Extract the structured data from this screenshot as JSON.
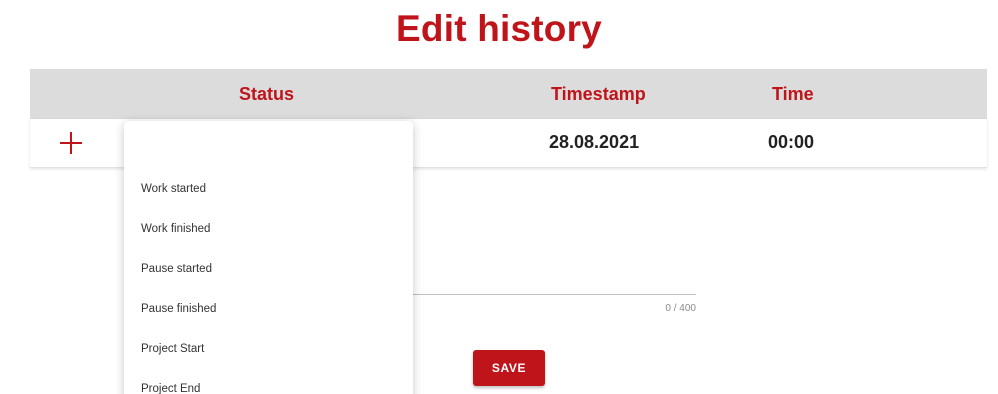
{
  "page": {
    "title": "Edit history"
  },
  "table": {
    "headers": {
      "status": "Status",
      "timestamp": "Timestamp",
      "time": "Time"
    },
    "row": {
      "timestamp": "28.08.2021",
      "time": "00:00"
    }
  },
  "status_dropdown": {
    "options": [
      "Work started",
      "Work finished",
      "Pause started",
      "Pause finished",
      "Project Start",
      "Project End"
    ]
  },
  "comment": {
    "counter": "0 / 400"
  },
  "actions": {
    "save_label": "SAVE"
  },
  "colors": {
    "accent": "#c0141b",
    "header_bg": "#dcdcdc"
  },
  "icons": {
    "add": "plus-icon"
  }
}
